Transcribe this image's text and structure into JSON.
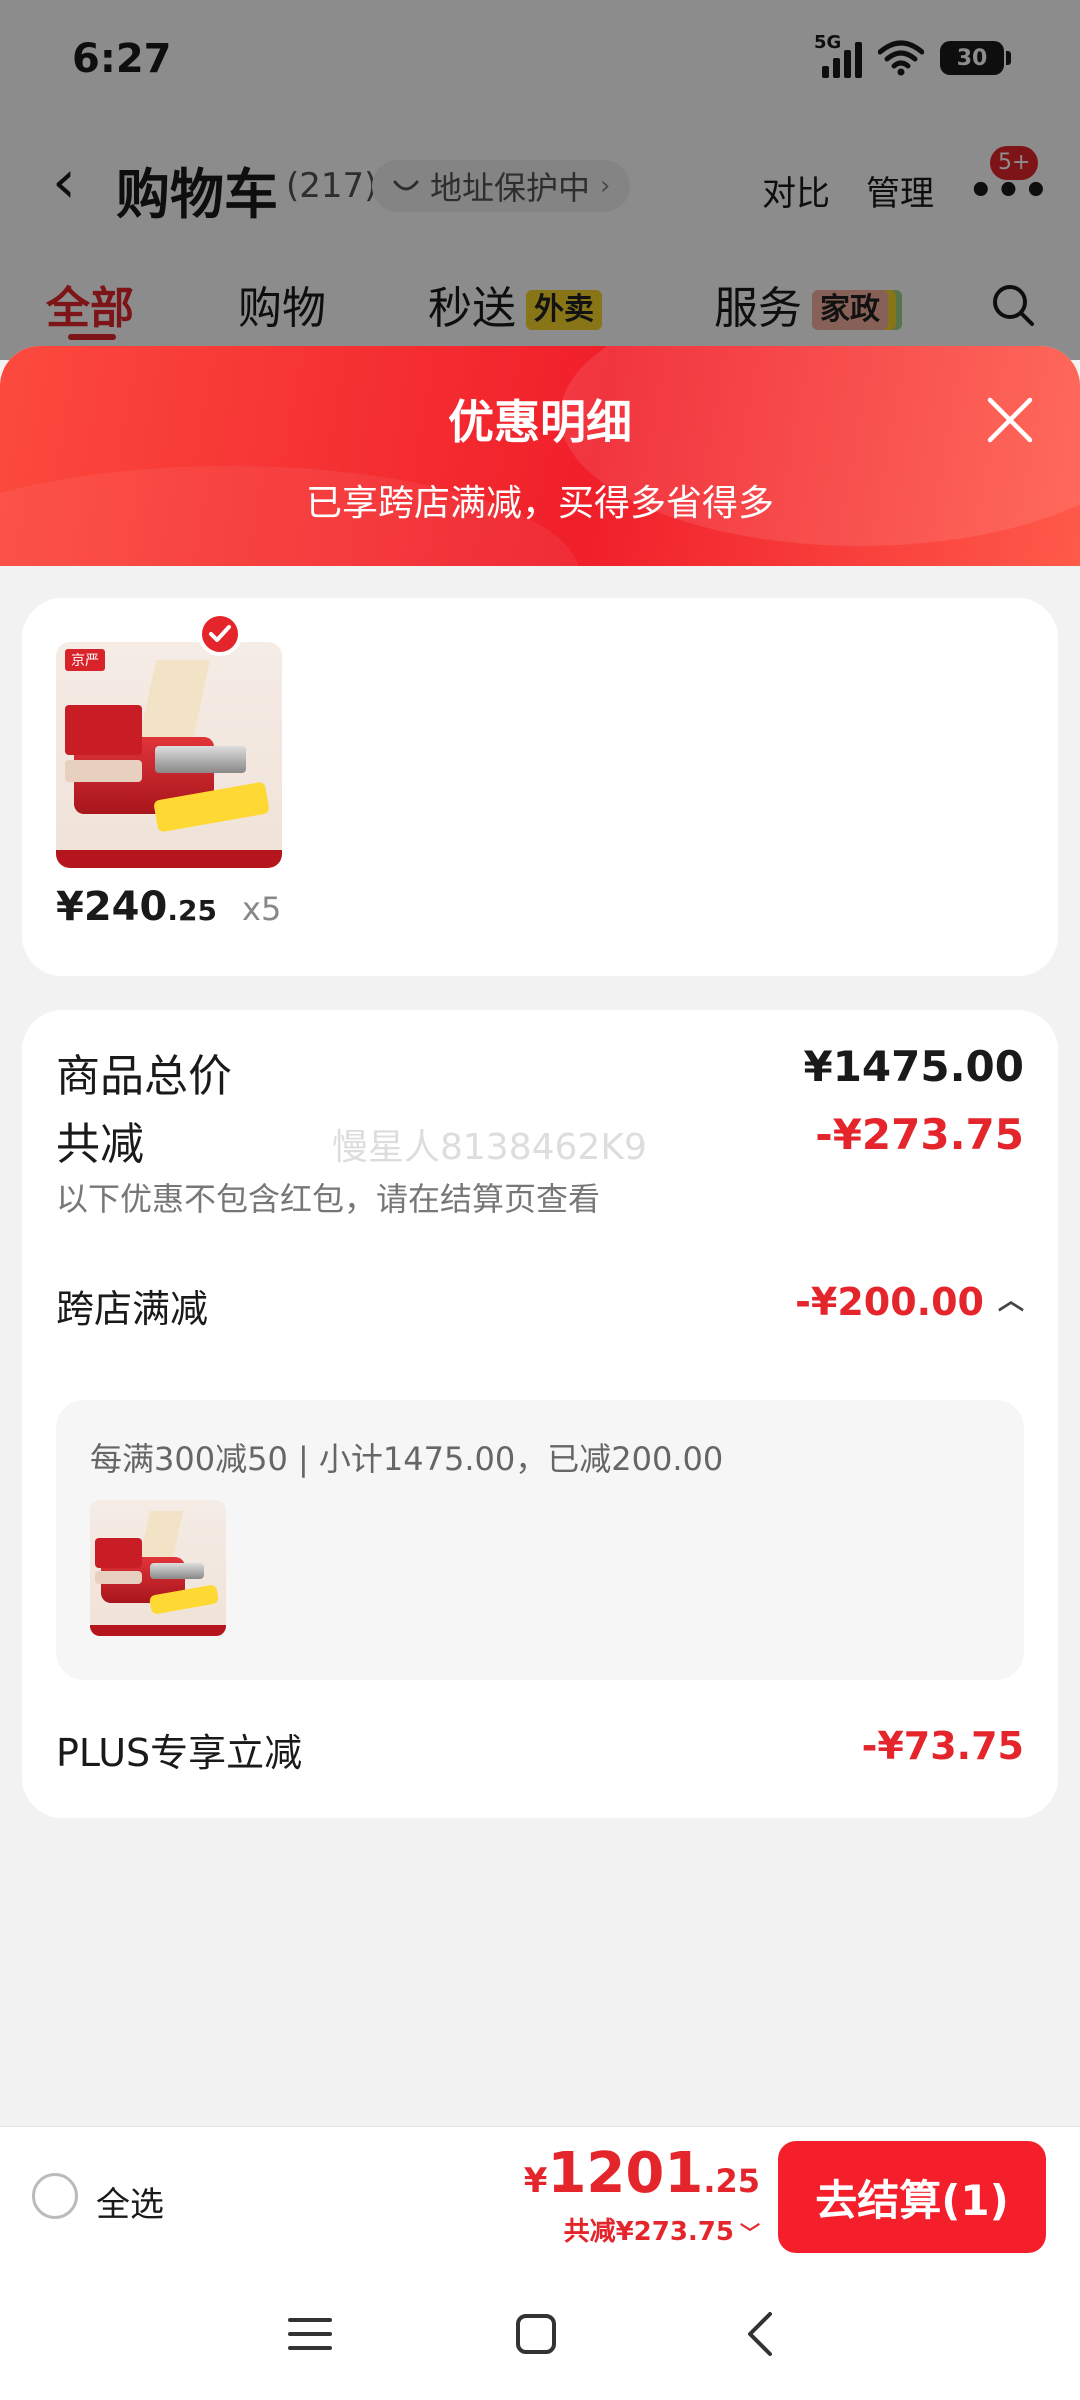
{
  "status_bar": {
    "time": "6:27",
    "network": "5G",
    "battery": "30"
  },
  "nav": {
    "title": "购物车",
    "count": "(217)",
    "address_chip": "地址保护中",
    "compare": "对比",
    "manage": "管理",
    "more_badge": "5+"
  },
  "tabs": [
    {
      "label": "全部"
    },
    {
      "label": "购物"
    },
    {
      "label": "秒送",
      "tag": "外卖"
    },
    {
      "label": "服务",
      "tag": "家政"
    }
  ],
  "modal": {
    "title": "优惠明细",
    "subtitle": "已享跨店满减，买得多省得多"
  },
  "product": {
    "price_int": "¥240",
    "price_dec": ".25",
    "quantity": "x5",
    "image_brand": "京严"
  },
  "summary": {
    "total_label": "商品总价",
    "total_value": "¥1475.00",
    "reduced_label": "共减",
    "reduced_value": "-¥273.75",
    "note": "以下优惠不包含红包，请在结算页查看",
    "watermark": "慢星人8138462K9",
    "cross_store_label": "跨店满减",
    "cross_store_value": "-¥200.00",
    "cross_store_detail": "每满300减50 | 小计1475.00，已减200.00",
    "plus_label": "PLUS专享立减",
    "plus_value": "-¥73.75"
  },
  "checkout": {
    "select_all": "全选",
    "currency": "¥",
    "total_int": "1201",
    "total_dec": ".25",
    "discount_text": "共减¥273.75",
    "button_label": "去结算(1)"
  },
  "colors": {
    "accent_red": "#e4262c",
    "checkout_button": "#f51f2c",
    "header_gradient_start": "#fc4a3e",
    "header_gradient_end": "#f01f2a"
  }
}
